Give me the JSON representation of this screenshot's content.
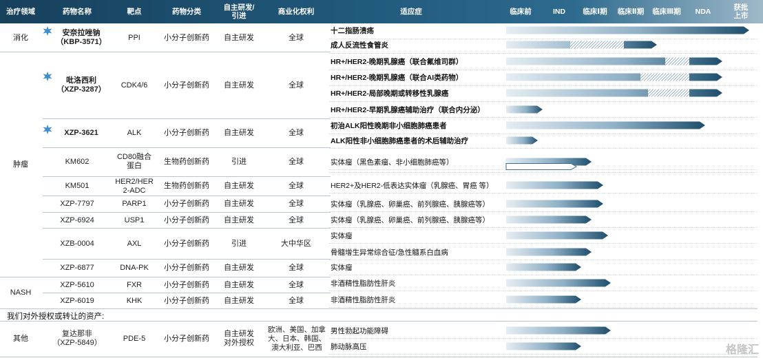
{
  "header": {
    "area": "治疗领域",
    "drug": "药物名称",
    "target": "靶点",
    "category": "药物分类",
    "source": "自主研发/\n引进",
    "rights": "商业化权利",
    "indication": "适应症",
    "stages": [
      "临床前",
      "IND",
      "临床Ⅰ期",
      "临床Ⅱ期",
      "临床Ⅲ期",
      "NDA",
      "获批\n上市"
    ]
  },
  "areas": {
    "digestion": "消化",
    "oncology": "肿瘤",
    "nash": "NASH",
    "other": "其他"
  },
  "drugs": [
    {
      "name": "安奈拉唑钠\n（KBP-3571）",
      "target": "PPI",
      "category": "小分子创新药",
      "source": "自主研发",
      "rights": "全球",
      "badge": "star-badge"
    },
    {
      "name": "吡洛西利\n（XZP-3287）",
      "target": "CDK4/6",
      "category": "小分子创新药",
      "source": "自主研发",
      "rights": "全球",
      "badge": "star-badge"
    },
    {
      "name": "XZP-3621",
      "target": "ALK",
      "category": "小分子创新药",
      "source": "自主研发",
      "rights": "全球",
      "badge": "star-badge"
    },
    {
      "name": "KM602",
      "target": "CD80融合\n蛋白",
      "category": "生物药创新药",
      "source": "引进",
      "rights": "全球"
    },
    {
      "name": "KM501",
      "target": "HER2/HER\n2-ADC",
      "category": "生物药创新药",
      "source": "自主研发",
      "rights": "全球"
    },
    {
      "name": "XZP-7797",
      "target": "PARP1",
      "category": "小分子创新药",
      "source": "自主研发",
      "rights": "全球"
    },
    {
      "name": "XZP-6924",
      "target": "USP1",
      "category": "小分子创新药",
      "source": "自主研发",
      "rights": "全球"
    },
    {
      "name": "XZB-0004",
      "target": "AXL",
      "category": "小分子创新药",
      "source": "引进",
      "rights": "大中华区"
    },
    {
      "name": "XZP-6877",
      "target": "DNA-PK",
      "category": "小分子创新药",
      "source": "自主研发",
      "rights": "全球"
    },
    {
      "name": "XZP-5610",
      "target": "FXR",
      "category": "小分子创新药",
      "source": "自主研发",
      "rights": "全球"
    },
    {
      "name": "XZP-6019",
      "target": "KHK",
      "category": "小分子创新药",
      "source": "自主研发",
      "rights": "全球"
    },
    {
      "name": "复达那非\n（XZP-5849）",
      "target": "PDE-5",
      "category": "小分子创新药",
      "source": "自主研发\n对外授权",
      "rights": "欧洲、美国、加拿\n大、日本、韩国、\n澳大利亚、巴西"
    }
  ],
  "indications": [
    {
      "text": "十二指肠溃疡",
      "bold": true,
      "progress": 1.0,
      "hatch": 0
    },
    {
      "text": "成人反流性食管炎",
      "bold": true,
      "progress": 0.62,
      "hatch": 0.22
    },
    {
      "text": "HR+/HER2-晚期乳腺癌（联合氟维司群）",
      "bold": true,
      "progress": 0.89,
      "hatch": 0.1
    },
    {
      "text": "HR+/HER2-晚期乳腺癌（联合AI类药物）",
      "bold": true,
      "progress": 0.89,
      "hatch": 0.2
    },
    {
      "text": "HR+/HER2-局部晚期或转移性乳腺癌",
      "bold": true,
      "progress": 0.89,
      "hatch": 0.17
    },
    {
      "text": "HR+/HER2-早期乳腺癌辅助治疗（联合内分泌）",
      "bold": true,
      "progress": 0.15,
      "hatch": 0
    },
    {
      "text": "初治ALK阳性晚期非小细胞肺癌患者",
      "bold": true,
      "progress": 0.82,
      "hatch": 0
    },
    {
      "text": "ALK阳性非小细胞肺癌患者的术后辅助治疗",
      "bold": true,
      "progress": 0.13,
      "hatch": 0
    },
    {
      "text": "实体瘤（黑色素瘤、非小细胞肺癌等）",
      "bold": false,
      "progress": 0.35,
      "hatch": 0
    },
    {
      "text": "",
      "bold": false,
      "progress": 0.29,
      "hatch": 0,
      "outline": true
    },
    {
      "text": "HER2+及HER2-低表达实体瘤（乳腺癌、胃癌 等）",
      "bold": false,
      "progress": 0.4,
      "hatch": 0
    },
    {
      "text": "实体瘤（乳腺癌、卵巢癌、前列腺癌、胰腺癌等）",
      "bold": false,
      "progress": 0.4,
      "hatch": 0
    },
    {
      "text": "实体瘤（乳腺癌、卵巢癌、前列腺癌、胰腺癌等）",
      "bold": false,
      "progress": 0.35,
      "hatch": 0
    },
    {
      "text": "实体瘤",
      "bold": false,
      "progress": 0.42,
      "hatch": 0
    },
    {
      "text": "骨髓增生异常综合征/急性髓系白血病",
      "bold": false,
      "progress": 0.35,
      "hatch": 0
    },
    {
      "text": "实体瘤",
      "bold": false,
      "progress": 0.31,
      "hatch": 0
    },
    {
      "text": "非酒精性脂肪性肝炎",
      "bold": false,
      "progress": 0.43,
      "hatch": 0
    },
    {
      "text": "非酒精性脂肪性肝炎",
      "bold": false,
      "progress": 0.31,
      "hatch": 0
    },
    {
      "text": "男性勃起功能障碍",
      "bold": false,
      "progress": 0.43,
      "hatch": 0
    },
    {
      "text": "肺动脉高压",
      "bold": false,
      "progress": 0.31,
      "hatch": 0
    }
  ],
  "section_note": "我们对外授权或转让的资产:",
  "watermark": "格隆汇",
  "colors": {
    "header": "#1f5577",
    "bar_dark": "#1d4e6c",
    "bar_light": "#e3eaf0"
  }
}
